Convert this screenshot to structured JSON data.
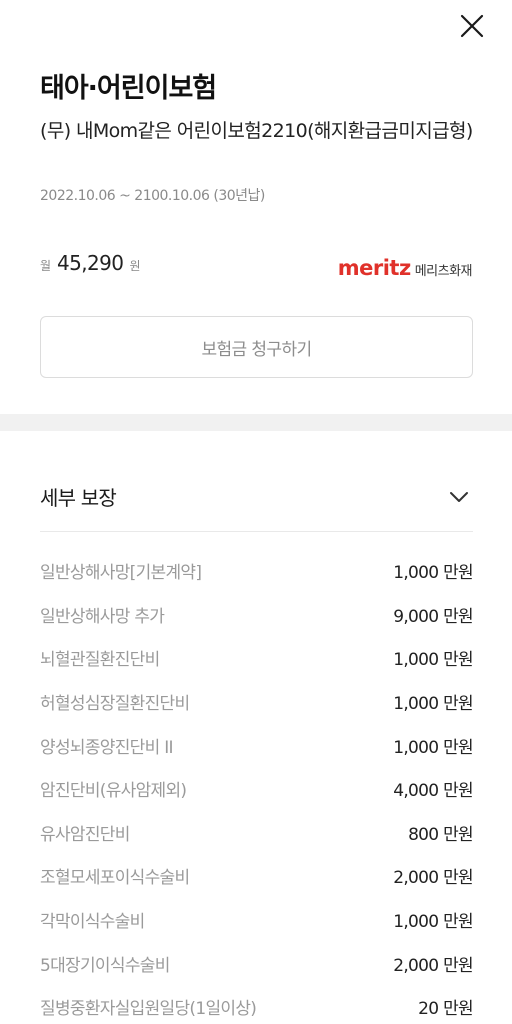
{
  "header": {
    "close_icon": "close-icon",
    "title": "태아·어린이보험",
    "subtitle": "(무) 내Mom같은 어린이보험2210(해지환급금미지급형)",
    "period": "2022.10.06 ~ 2100.10.06 (30년납)"
  },
  "premium": {
    "prefix": "월",
    "amount": "45,290",
    "suffix": "원"
  },
  "insurer": {
    "logo_word": "meritz",
    "name": "메리츠화재",
    "brand_color": "#e0312a"
  },
  "claim_button": {
    "label": "보험금 청구하기"
  },
  "coverage": {
    "title": "세부 보장",
    "toggle_icon": "chevron-down-icon",
    "items": [
      {
        "name": "일반상해사망[기본계약]",
        "value": "1,000 만원"
      },
      {
        "name": "일반상해사망 추가",
        "value": "9,000 만원"
      },
      {
        "name": "뇌혈관질환진단비",
        "value": "1,000 만원"
      },
      {
        "name": "허혈성심장질환진단비",
        "value": "1,000 만원"
      },
      {
        "name": "양성뇌종양진단비 II",
        "value": "1,000 만원"
      },
      {
        "name": "암진단비(유사암제외)",
        "value": "4,000 만원"
      },
      {
        "name": "유사암진단비",
        "value": "800 만원"
      },
      {
        "name": "조혈모세포이식수술비",
        "value": "2,000 만원"
      },
      {
        "name": "각막이식수술비",
        "value": "1,000 만원"
      },
      {
        "name": "5대장기이식수술비",
        "value": "2,000 만원"
      },
      {
        "name": "질병중환자실입원일당(1일이상)",
        "value": "20 만원"
      }
    ]
  }
}
